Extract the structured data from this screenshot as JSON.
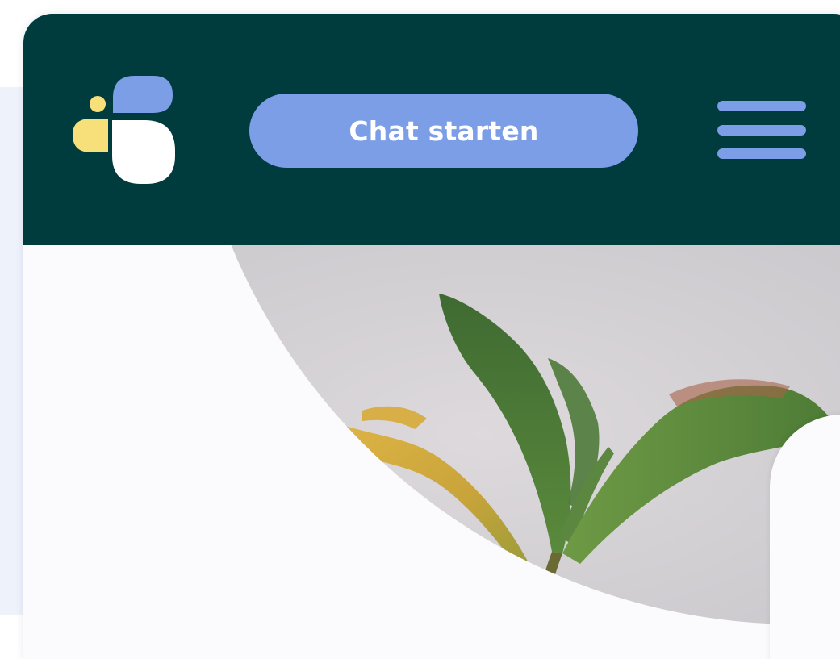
{
  "header": {
    "logo_icon": "brand-logo-icon",
    "chat_button_label": "Chat starten",
    "menu_icon": "hamburger-menu-icon"
  },
  "hero": {
    "image": "plant-seedling-photo"
  },
  "colors": {
    "header_bg": "#003b3e",
    "accent_blue": "#7b9ee6",
    "logo_yellow": "#f7e07a",
    "logo_white": "#ffffff",
    "page_bg": "#fbfbfd",
    "side_bg": "#eef2fb"
  }
}
